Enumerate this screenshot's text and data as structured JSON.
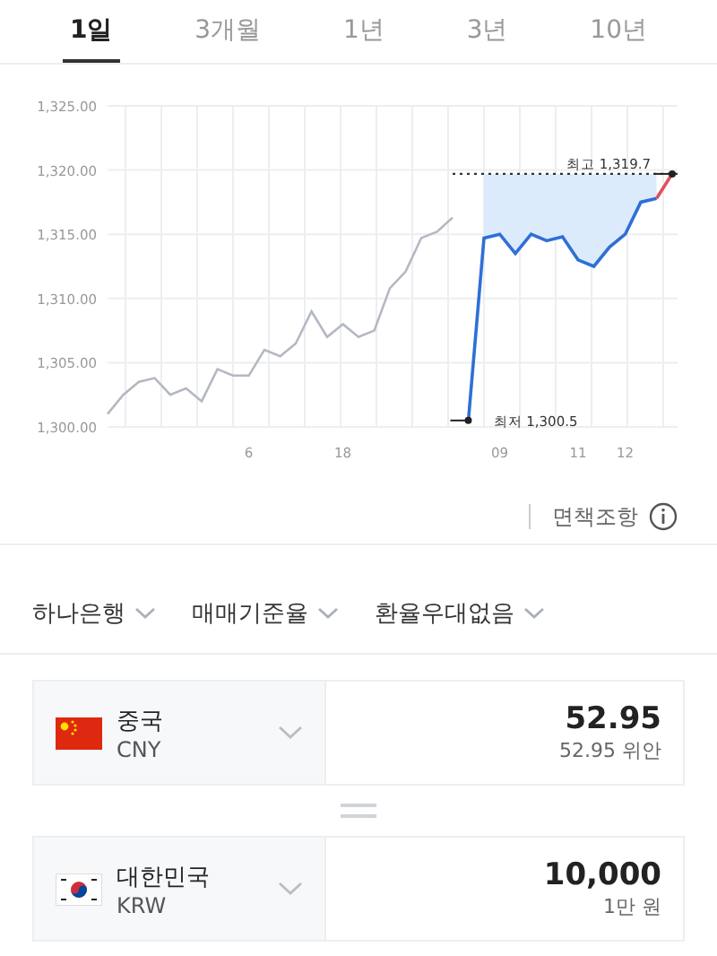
{
  "tabs": [
    {
      "label": "1일",
      "selected": true
    },
    {
      "label": "3개월",
      "selected": false
    },
    {
      "label": "1년",
      "selected": false
    },
    {
      "label": "3년",
      "selected": false
    },
    {
      "label": "10년",
      "selected": false
    }
  ],
  "chart": {
    "chart_data": {
      "type": "line",
      "categories": [
        null,
        null,
        null,
        null,
        null,
        null,
        null,
        null,
        null,
        "6",
        null,
        null,
        null,
        null,
        null,
        "18",
        null,
        null,
        null,
        null,
        null,
        null,
        null,
        null,
        null,
        "09",
        null,
        null,
        null,
        null,
        "11",
        null,
        null,
        "12",
        null,
        null,
        null
      ],
      "series": [
        {
          "color": "#b4b8c2",
          "values": [
            1301,
            1302.5,
            1303.5,
            1303.8,
            1302.5,
            1303,
            1302,
            1304.5,
            1304,
            1304,
            1306,
            1305.5,
            1306.5,
            1309,
            1307,
            1308,
            1307,
            1307.5,
            1310.8,
            1312.1,
            1314.7,
            1315.2,
            1316.3,
            null,
            null,
            null,
            null,
            null,
            null,
            null,
            null,
            null,
            null,
            null,
            null,
            null,
            null
          ]
        },
        {
          "color": "#2f6fd6",
          "values": [
            null,
            null,
            null,
            null,
            null,
            null,
            null,
            null,
            null,
            null,
            null,
            null,
            null,
            null,
            null,
            null,
            null,
            null,
            null,
            null,
            null,
            null,
            null,
            1300.5,
            1314.7,
            1315,
            1313.5,
            1315,
            1314.5,
            1314.8,
            1313,
            1312.5,
            1314,
            1315,
            1317.5,
            1317.8,
            null
          ]
        },
        {
          "color": "#e0505a",
          "values": [
            null,
            null,
            null,
            null,
            null,
            null,
            null,
            null,
            null,
            null,
            null,
            null,
            null,
            null,
            null,
            null,
            null,
            null,
            null,
            null,
            null,
            null,
            null,
            null,
            null,
            null,
            null,
            null,
            null,
            null,
            null,
            null,
            null,
            null,
            null,
            1317.8,
            1319.7
          ]
        }
      ],
      "ylim": [
        1300,
        1325
      ],
      "yticks": [
        {
          "value": 1300,
          "label": "1,300.00"
        },
        {
          "value": 1305,
          "label": "1,305.00"
        },
        {
          "value": 1310,
          "label": "1,310.00"
        },
        {
          "value": 1315,
          "label": "1,315.00"
        },
        {
          "value": 1320,
          "label": "1,320.00"
        },
        {
          "value": 1325,
          "label": "1,325.00"
        }
      ],
      "grid": true,
      "ref_lines": [
        {
          "axis": "y",
          "value": 1319.7
        }
      ],
      "annotations": [
        "최고 1,319.7",
        "최저 1,300.5"
      ]
    }
  },
  "disclaimer": "면책조항",
  "filters": [
    {
      "label": "하나은행"
    },
    {
      "label": "매매기준율"
    },
    {
      "label": "환율우대없음"
    }
  ],
  "currencies": [
    {
      "name": "중국",
      "code": "CNY",
      "amount": "52.95",
      "amount_text": "52.95 위안"
    },
    {
      "name": "대한민국",
      "code": "KRW",
      "amount": "10,000",
      "amount_text": "1만 원"
    }
  ]
}
